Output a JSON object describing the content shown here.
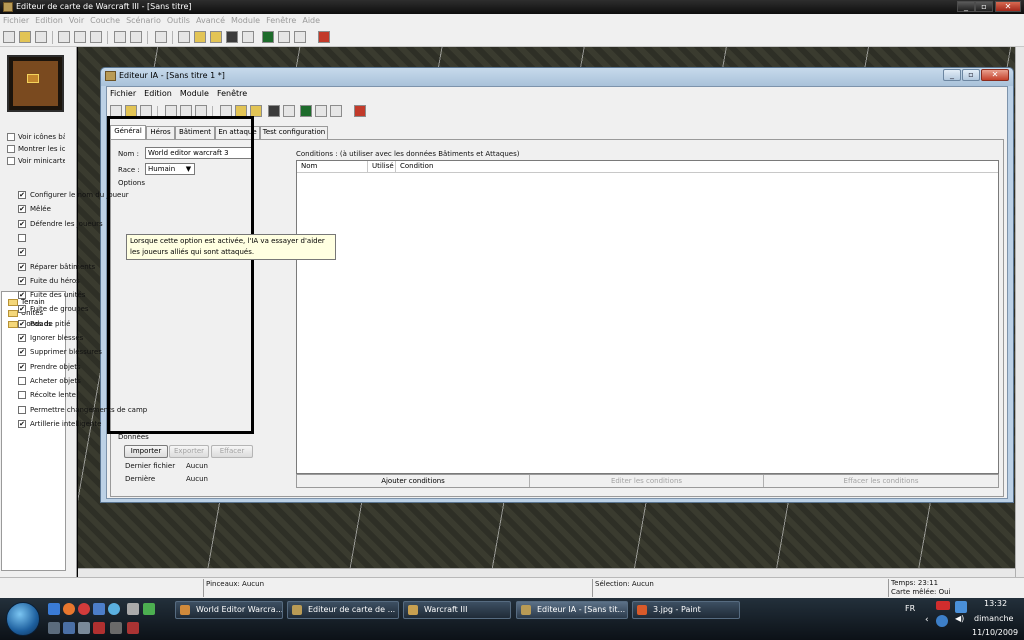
{
  "app": {
    "title": "Editeur de carte de Warcraft III - [Sans titre]",
    "menu": [
      "Fichier",
      "Edition",
      "Voir",
      "Couche",
      "Scénario",
      "Outils",
      "Avancé",
      "Module",
      "Fenêtre",
      "Aide"
    ],
    "left_checks": [
      "Voir icônes bâ",
      "Montrer les ic",
      "Voir minicarte"
    ],
    "tree": [
      "Terrain",
      "Unités",
      "Doodads"
    ],
    "status": {
      "pinceaux": "Pinceaux: Aucun",
      "selection": "Sélection: Aucun",
      "temps": "Temps: 23:11",
      "carte": "Carte mêlée: Oui"
    }
  },
  "ia": {
    "title": "Editeur IA - [Sans titre 1 *]",
    "menu": [
      "Fichier",
      "Edition",
      "Module",
      "Fenêtre"
    ],
    "tabs": [
      "Général",
      "Héros",
      "Bâtiment",
      "En attaque",
      "Test configuration"
    ],
    "nom_label": "Nom :",
    "nom_value": "World editor warcraft 3",
    "race_label": "Race :",
    "race_value": "Humain",
    "options_label": "Options",
    "options": [
      {
        "label": "Configurer le nom du joueur",
        "checked": true
      },
      {
        "label": "Mêlée",
        "checked": true
      },
      {
        "label": "Défendre les joueurs",
        "checked": true
      },
      {
        "label": "",
        "checked": false
      },
      {
        "label": "",
        "checked": true
      },
      {
        "label": "Réparer bâtiments",
        "checked": true
      },
      {
        "label": "Fuite du héros",
        "checked": true
      },
      {
        "label": "Fuite des unités",
        "checked": true
      },
      {
        "label": "Fuite de groupes",
        "checked": true
      },
      {
        "label": "Pas de pitié",
        "checked": true
      },
      {
        "label": "Ignorer blessés",
        "checked": true
      },
      {
        "label": "Supprimer blessures",
        "checked": true
      },
      {
        "label": "Prendre objets",
        "checked": true
      },
      {
        "label": "Acheter objets",
        "checked": false
      },
      {
        "label": "Récolte lente",
        "checked": false
      },
      {
        "label": "Permettre changements de camp",
        "checked": false
      },
      {
        "label": "Artillerie intelligente",
        "checked": true
      }
    ],
    "donnees_label": "Données",
    "importer": "Importer",
    "exporter": "Exporter",
    "effacer": "Effacer",
    "dernier_fichier_label": "Dernier fichier",
    "dernier_fichier_value": "Aucun",
    "derniere_label": "Dernière",
    "derniere_value": "Aucun",
    "tooltip_line1": "Lorsque cette option est activée, l'IA va essayer d'aider",
    "tooltip_line2": "les joueurs alliés qui sont attaqués.",
    "conditions_label": "Conditions : (à utiliser avec les données Bâtiments et Attaques)",
    "columns": [
      "Nom",
      "Utilisé",
      "Condition"
    ],
    "cond_buttons": [
      "Ajouter conditions",
      "Editer les conditions",
      "Effacer les conditions"
    ]
  },
  "taskbar": {
    "tasks": [
      "World Editor Warcra...",
      "Editeur de carte de ...",
      "Warcraft III",
      "Editeur IA - [Sans tit...",
      "3.jpg - Paint"
    ],
    "lang": "FR",
    "time": "13:32",
    "day": "dimanche",
    "date": "11/10/2009"
  },
  "colors": {
    "desktop": "#000000",
    "window_frame": "#bcd1e6",
    "tooltip_bg": "#ffffe1",
    "taskbar": "#1a2430"
  }
}
